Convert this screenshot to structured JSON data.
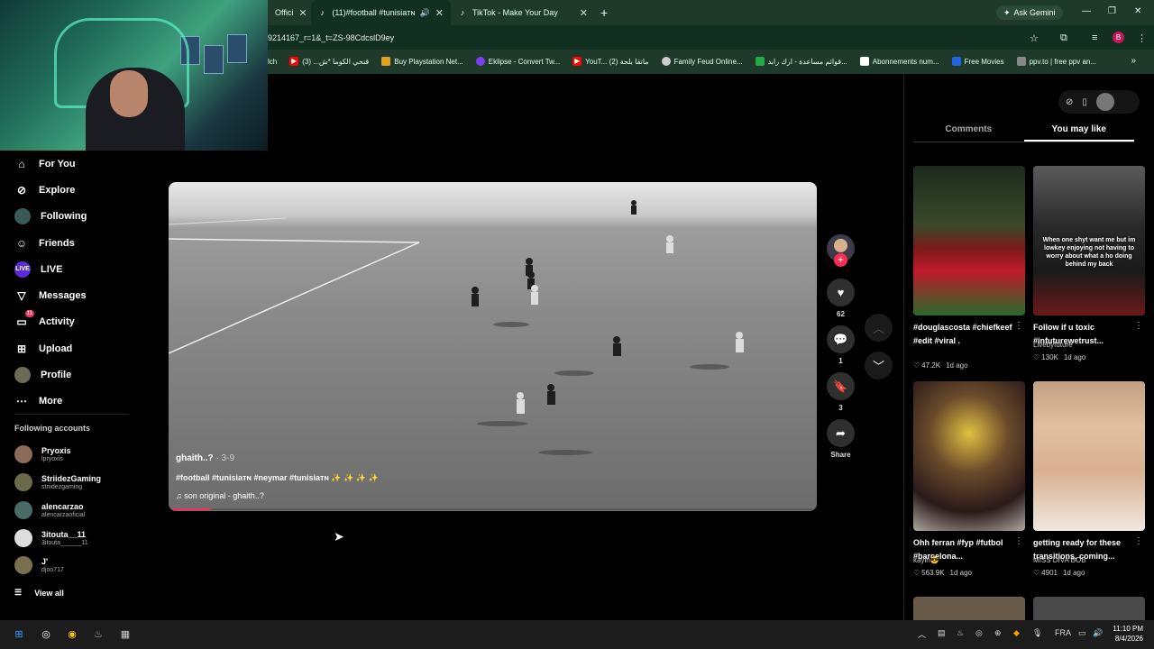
{
  "browser": {
    "tabs": [
      {
        "label": "Offici",
        "active": false
      },
      {
        "label": "(11)#football #tunisiaᴛɴ #n",
        "active": true
      },
      {
        "label": "TikTok - Make Your Day",
        "active": false
      }
    ],
    "ask_gemini": "Ask Gemini",
    "url": "9214167_r=1&_t=ZS-98CdcslD9ey",
    "profile_initial": "B",
    "bookmarks": [
      {
        "label": "lch",
        "color": "#333"
      },
      {
        "label": "قنحي الكوما *ش... (3)",
        "color": "#ff0000"
      },
      {
        "label": "Buy Playstation Net...",
        "color": "#e0a020"
      },
      {
        "label": "Eklipse - Convert Tw...",
        "color": "#7b3ff2"
      },
      {
        "label": "YouT... ماتقا بلحة (2)",
        "color": "#ff0000"
      },
      {
        "label": "Family Feud Online...",
        "color": "#cccccc"
      },
      {
        "label": "قوائم مساعدة - ارك رابد...",
        "color": "#22aa44"
      },
      {
        "label": "Abonnements num...",
        "color": "#ffffff"
      },
      {
        "label": "Free Movies",
        "color": "#2266dd"
      },
      {
        "label": "ppv.to | free ppv an...",
        "color": "#888888"
      }
    ]
  },
  "sidebar": {
    "items": [
      {
        "label": "For You",
        "icon": "home-icon"
      },
      {
        "label": "Explore",
        "icon": "compass-icon"
      },
      {
        "label": "Following",
        "icon": "following-avatar-icon"
      },
      {
        "label": "Friends",
        "icon": "friends-icon"
      },
      {
        "label": "LIVE",
        "icon": "live-icon"
      },
      {
        "label": "Messages",
        "icon": "messages-icon"
      },
      {
        "label": "Activity",
        "icon": "activity-icon",
        "badge": "11"
      },
      {
        "label": "Upload",
        "icon": "upload-icon"
      },
      {
        "label": "Profile",
        "icon": "profile-icon"
      },
      {
        "label": "More",
        "icon": "more-icon"
      }
    ],
    "following_header": "Following accounts",
    "accounts": [
      {
        "name": "Pryoxis",
        "handle": "lpryoxis"
      },
      {
        "name": "StriidezGaming",
        "handle": "striidezgaming"
      },
      {
        "name": "alencarzao",
        "handle": "alencarzaoficial"
      },
      {
        "name": "3itouta__11",
        "handle": "3itouta______11"
      },
      {
        "name": "J'",
        "handle": "djoo717"
      }
    ],
    "view_all": "View all"
  },
  "video": {
    "author": "ghaith..?",
    "date": " · 3-9",
    "caption": "#football #tunisiaᴛɴ #neymar #tunisiaᴛɴ ✨ ✨ ✨ ✨",
    "sound": "son original - ghaith..?",
    "progress": 0.06
  },
  "actions": {
    "likes": "62",
    "comments": "1",
    "saves": "3",
    "share_label": "Share"
  },
  "right_panel": {
    "tabs": [
      "Comments",
      "You may like"
    ],
    "active_tab": "You may like",
    "cards": [
      {
        "title": "#douglascosta #chiefkeef #edit #viral .",
        "author": "",
        "likes": "47.2K",
        "age": "1d ago",
        "overlay": ""
      },
      {
        "title": "Follow if u toxic #infuturewetrust...",
        "author": "Livebyfuture",
        "likes": "130K",
        "age": "1d ago",
        "overlay": "When one shyt want me but im lowkey enjoying not having to worry about what a ho doing behind my back"
      },
      {
        "title": "Ohh ferran #fyp #futbol #barcelona...",
        "author": "kayin😎",
        "likes": "563.9K",
        "age": "1d ago",
        "overlay": ""
      },
      {
        "title": "getting ready for these transitions, coming...",
        "author": "MISS DIVA BOB",
        "likes": "4901",
        "age": "1d ago",
        "overlay": ""
      }
    ]
  },
  "taskbar": {
    "lang": "FRA",
    "time": "11:10 PM",
    "date": "8/4/2026"
  }
}
